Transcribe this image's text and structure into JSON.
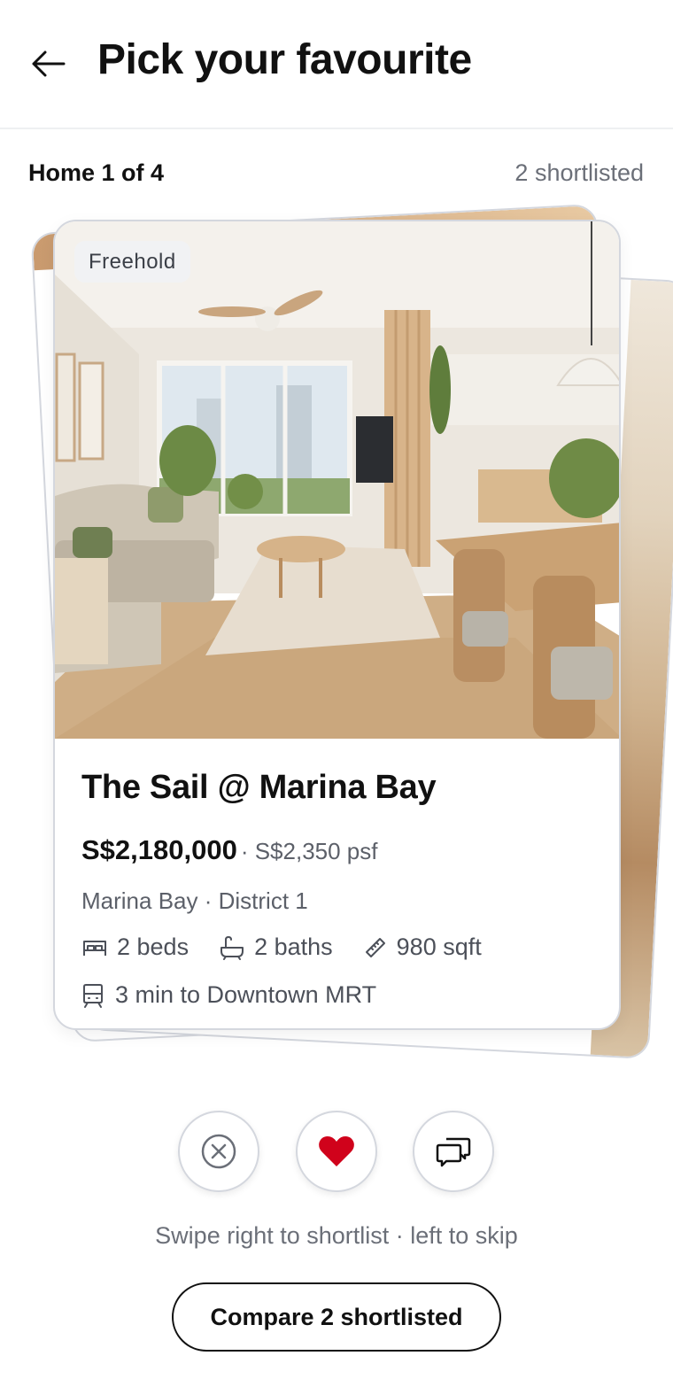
{
  "header": {
    "title": "Pick your favourite",
    "back_icon": "arrow-left-icon"
  },
  "status": {
    "counter": "Home 1 of 4",
    "shortlisted": "2 shortlisted"
  },
  "listing": {
    "tenure": "Freehold",
    "name": "The Sail @ Marina Bay",
    "price": "S$2,180,000",
    "psf": "· S$2,350 psf",
    "location": "Marina Bay · District 1",
    "beds": "2 beds",
    "baths": "2 baths",
    "size": "980 sqft",
    "mrt": "3 min to Downtown MRT"
  },
  "actions": {
    "skip_icon": "close-circle-icon",
    "like_icon": "heart-icon",
    "chat_icon": "chat-icon",
    "like_color": "#d0021b"
  },
  "hint": "Swipe right to shortlist · left to skip",
  "compare_label": "Compare 2 shortlisted"
}
